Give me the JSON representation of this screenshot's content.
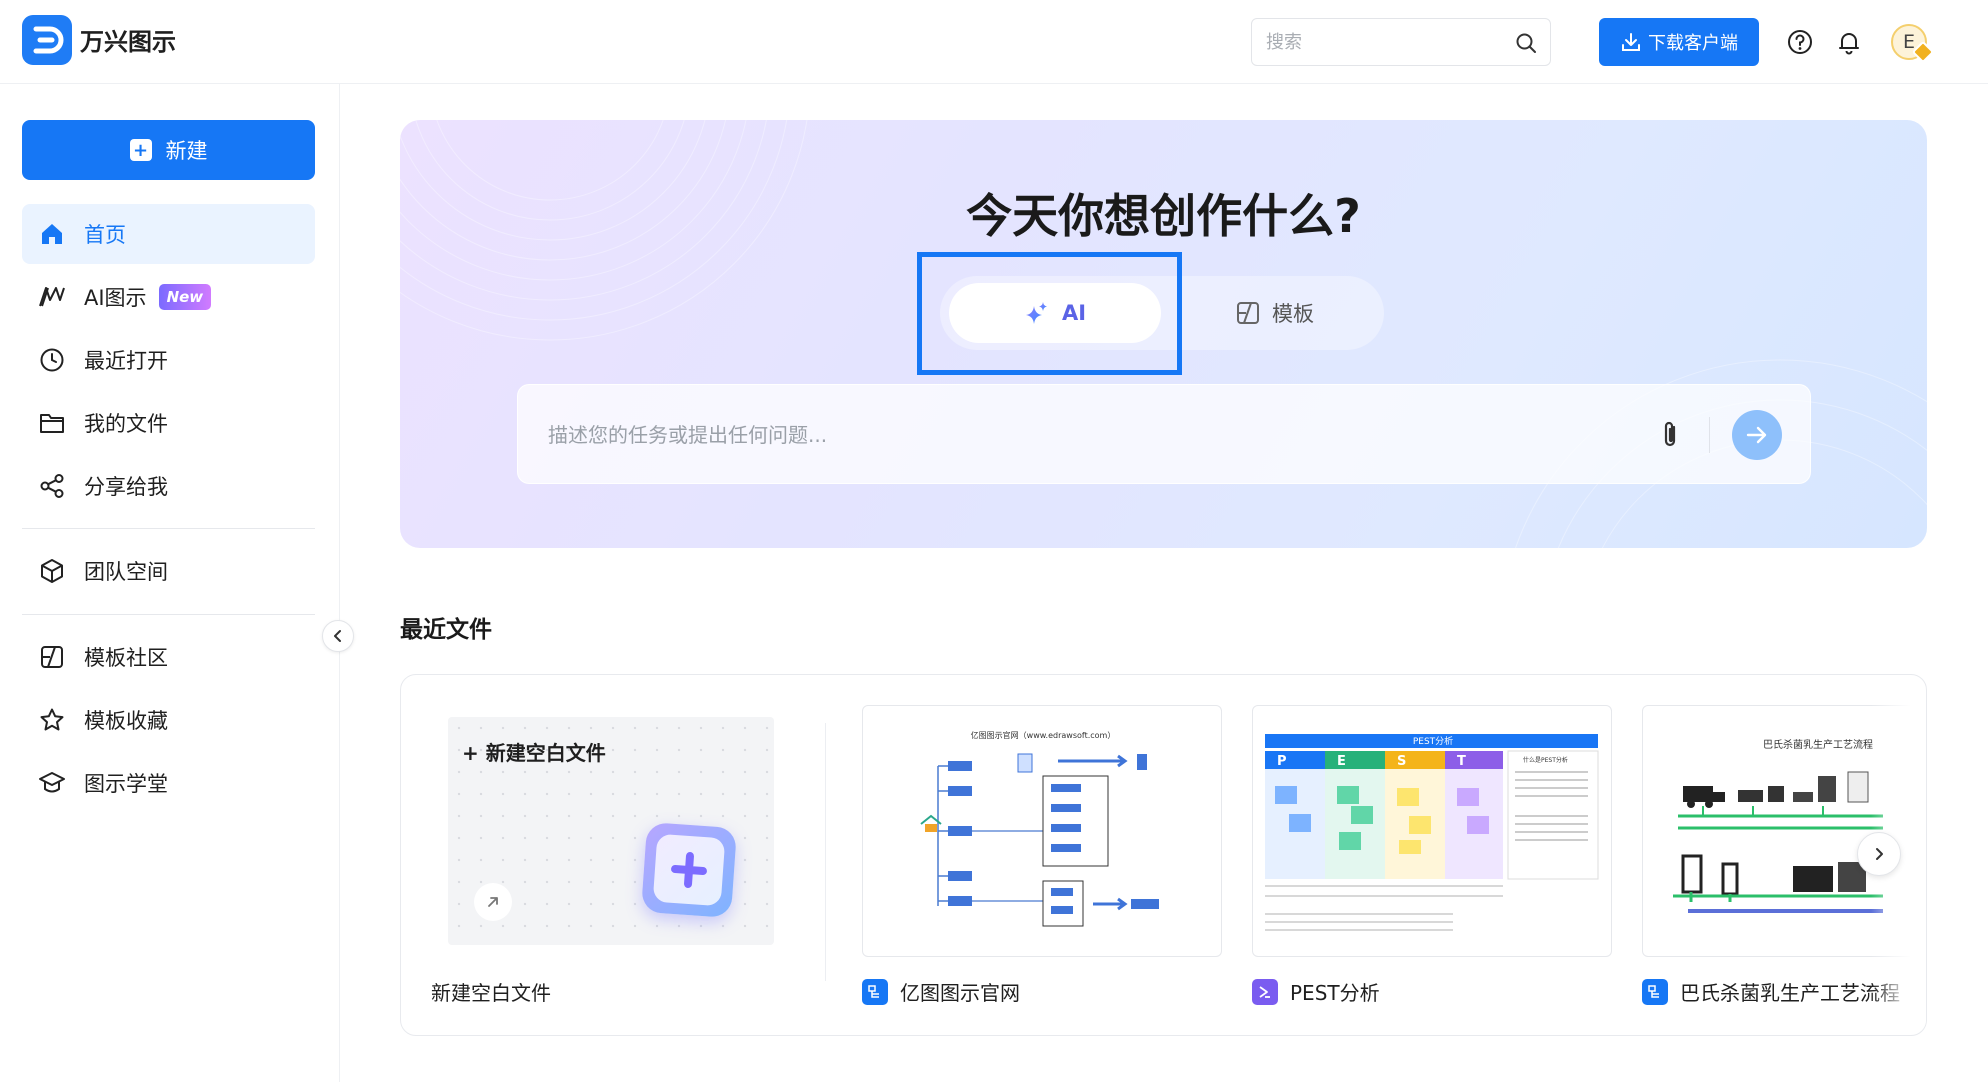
{
  "app": {
    "brand": "万兴图示",
    "accent": "#1677f5"
  },
  "header": {
    "search_placeholder": "搜索",
    "download_label": "下载客户端",
    "avatar_letter": "E"
  },
  "sidebar": {
    "new_label": "新建",
    "items": [
      {
        "label": "首页",
        "icon": "home-icon",
        "active": true
      },
      {
        "label": "AI图示",
        "icon": "ai-diagram-icon",
        "badge": "New"
      },
      {
        "label": "最近打开",
        "icon": "clock-icon"
      },
      {
        "label": "我的文件",
        "icon": "folder-icon"
      },
      {
        "label": "分享给我",
        "icon": "share-icon"
      },
      {
        "label": "团队空间",
        "icon": "cube-icon"
      },
      {
        "label": "模板社区",
        "icon": "template-icon"
      },
      {
        "label": "模板收藏",
        "icon": "star-icon"
      },
      {
        "label": "图示学堂",
        "icon": "graduation-cap-icon"
      }
    ]
  },
  "hero": {
    "title": "今天你想创作什么?",
    "tab_ai": "AI",
    "tab_template": "模板",
    "prompt_placeholder": "描述您的任务或提出任何问题..."
  },
  "recent": {
    "title": "最近文件",
    "blank_card_label": "+ 新建空白文件",
    "files": [
      {
        "name": "新建空白文件"
      },
      {
        "name": "亿图图示官网",
        "icon": "org-file-icon",
        "icon_color": "#1677f5"
      },
      {
        "name": "PEST分析",
        "icon": "pest-file-icon",
        "icon_color": "#7a5cf0"
      },
      {
        "name": "巴氏杀菌乳生产工艺流程",
        "icon": "org-file-icon",
        "icon_color": "#1677f5"
      }
    ],
    "thumb_titles": {
      "site": "亿图图示官网（www.edrawsoft.com）",
      "pest": "PEST分析",
      "pest_letters": [
        "P",
        "E",
        "S",
        "T"
      ],
      "pest_side": "什么是PEST分析",
      "process": "巴氏杀菌乳生产工艺流程"
    }
  }
}
